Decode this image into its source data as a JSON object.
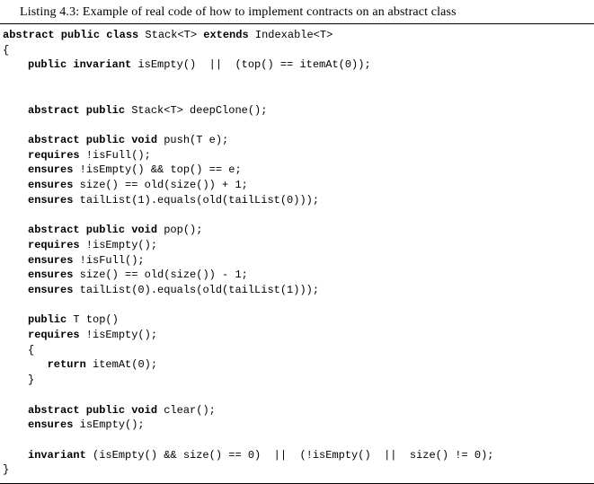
{
  "caption": "Listing 4.3: Example of real code of how to implement contracts on an abstract class",
  "code": {
    "l1a": "abstract public class",
    "l1b": " Stack<T> ",
    "l1c": "extends",
    "l1d": " Indexable<T>",
    "l2": "{",
    "l3a": "public invariant",
    "l3b": " isEmpty()  ||  (top() == itemAt(0));",
    "l4a": "abstract public",
    "l4b": " Stack<T> deepClone();",
    "l5a": "abstract public void",
    "l5b": " push(T e);",
    "l6a": "requires",
    "l6b": " !isFull();",
    "l7a": "ensures",
    "l7b": " !isEmpty() && top() == e;",
    "l8a": "ensures",
    "l8b": " size() == old(size()) + 1;",
    "l9a": "ensures",
    "l9b": " tailList(1).equals(old(tailList(0)));",
    "l10a": "abstract public void",
    "l10b": " pop();",
    "l11a": "requires",
    "l11b": " !isEmpty();",
    "l12a": "ensures",
    "l12b": " !isFull();",
    "l13a": "ensures",
    "l13b": " size() == old(size()) - 1;",
    "l14a": "ensures",
    "l14b": " tailList(0).equals(old(tailList(1)));",
    "l15a": "public",
    "l15b": " T top()",
    "l16a": "requires",
    "l16b": " !isEmpty();",
    "l17": "{",
    "l18a": "return",
    "l18b": " itemAt(0);",
    "l19": "}",
    "l20a": "abstract public void",
    "l20b": " clear();",
    "l21a": "ensures",
    "l21b": " isEmpty();",
    "l22a": "invariant",
    "l22b": " (isEmpty() && size() == 0)  ||  (!isEmpty()  ||  size() != 0);",
    "l23": "}"
  }
}
